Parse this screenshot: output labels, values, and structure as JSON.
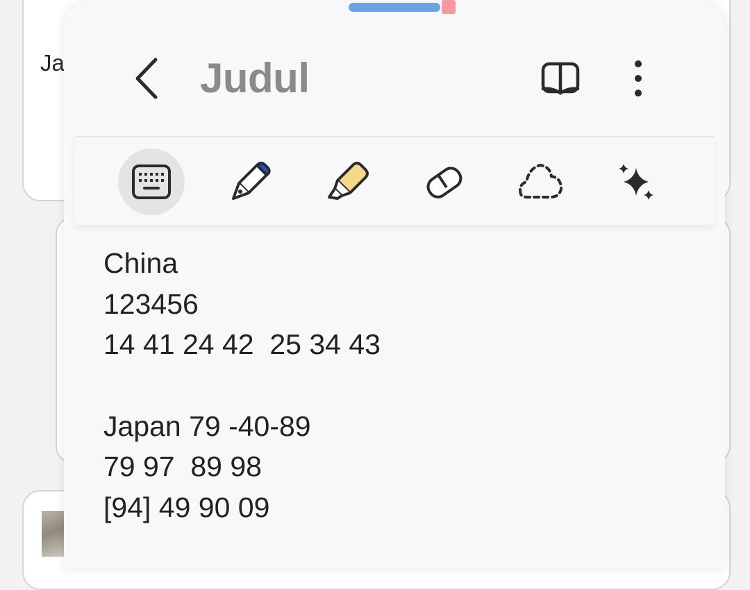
{
  "background": {
    "snippet": "Ja"
  },
  "header": {
    "title": "Judul",
    "back_icon": "chevron-left-icon",
    "reader_icon": "book-open-icon",
    "more_icon": "more-vertical-icon"
  },
  "toolbar": {
    "tools": [
      {
        "icon": "keyboard-icon",
        "active": true
      },
      {
        "icon": "fountain-pen-icon",
        "color": "#1f4fe0"
      },
      {
        "icon": "highlighter-icon",
        "color": "#f3d98b"
      },
      {
        "icon": "eraser-icon"
      },
      {
        "icon": "lasso-select-icon"
      },
      {
        "icon": "ai-sparkle-icon"
      }
    ]
  },
  "note": {
    "lines": [
      "China",
      "123456",
      "14 41 24 42  25 34 43",
      "",
      "Japan 79 -40-89",
      "79 97  89 98",
      "[94] 49 90 09"
    ]
  },
  "colors": {
    "accent_handle": "#6aa4e2",
    "title_gray": "#8a8a8c",
    "text": "#222222",
    "sheet_bg": "#f8f8fa"
  }
}
